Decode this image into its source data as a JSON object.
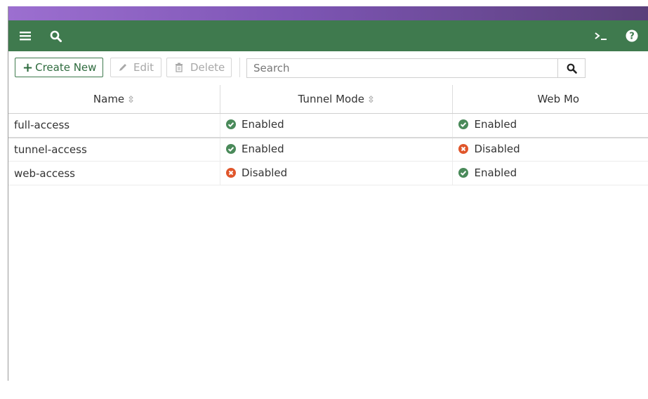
{
  "colors": {
    "header_green": "#3f7a4e",
    "enabled": "#4a8a5a",
    "disabled": "#e0562b",
    "gradient_start": "#9c6fd0",
    "gradient_end": "#5a3f7a"
  },
  "topbar": {
    "menu_icon": "hamburger-menu-icon",
    "search_icon": "search-icon",
    "cli_icon": "cli-console-icon",
    "help_icon": "help-icon"
  },
  "toolbar": {
    "create_label": "Create New",
    "edit_label": "Edit",
    "delete_label": "Delete",
    "search_placeholder": "Search"
  },
  "table": {
    "headers": {
      "name": "Name",
      "tunnel": "Tunnel Mode",
      "web": "Web Mo"
    },
    "rows": [
      {
        "name": "full-access",
        "tunnel": "Enabled",
        "web": "Enabled"
      },
      {
        "name": "tunnel-access",
        "tunnel": "Enabled",
        "web": "Disabled"
      },
      {
        "name": "web-access",
        "tunnel": "Disabled",
        "web": "Enabled"
      }
    ]
  }
}
